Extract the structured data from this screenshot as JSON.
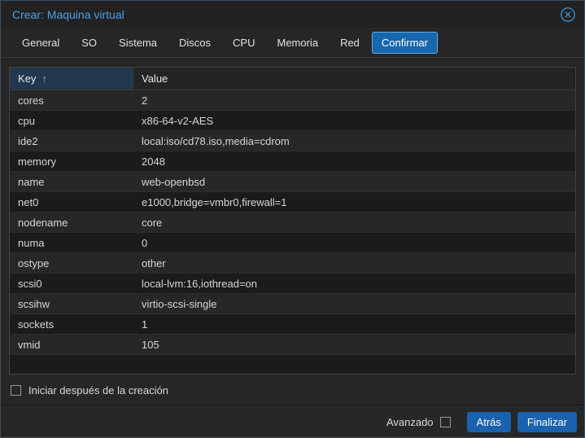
{
  "window": {
    "title": "Crear: Maquina virtual"
  },
  "icons": {
    "sort_asc_glyph": "↑"
  },
  "tabs": [
    {
      "label": "General",
      "active": false
    },
    {
      "label": "SO",
      "active": false
    },
    {
      "label": "Sistema",
      "active": false
    },
    {
      "label": "Discos",
      "active": false
    },
    {
      "label": "CPU",
      "active": false
    },
    {
      "label": "Memoria",
      "active": false
    },
    {
      "label": "Red",
      "active": false
    },
    {
      "label": "Confirmar",
      "active": true
    }
  ],
  "grid": {
    "key_header": "Key",
    "value_header": "Value",
    "sort_direction": "asc",
    "rows": [
      {
        "key": "cores",
        "value": "2"
      },
      {
        "key": "cpu",
        "value": "x86-64-v2-AES"
      },
      {
        "key": "ide2",
        "value": "local:iso/cd78.iso,media=cdrom"
      },
      {
        "key": "memory",
        "value": "2048"
      },
      {
        "key": "name",
        "value": "web-openbsd"
      },
      {
        "key": "net0",
        "value": "e1000,bridge=vmbr0,firewall=1"
      },
      {
        "key": "nodename",
        "value": "core"
      },
      {
        "key": "numa",
        "value": "0"
      },
      {
        "key": "ostype",
        "value": "other"
      },
      {
        "key": "scsi0",
        "value": "local-lvm:16,iothread=on"
      },
      {
        "key": "scsihw",
        "value": "virtio-scsi-single"
      },
      {
        "key": "sockets",
        "value": "1"
      },
      {
        "key": "vmid",
        "value": "105"
      }
    ]
  },
  "options": {
    "start_after_create_label": "Iniciar después de la creación",
    "start_after_create_checked": false
  },
  "footer": {
    "advanced_label": "Avanzado",
    "advanced_checked": false,
    "back_button": "Atrás",
    "finish_button": "Finalizar"
  },
  "colors": {
    "title_blue": "#4aa0e8",
    "accent_blue": "#1a62ae",
    "active_tab_border": "#6aabdf",
    "sorted_column_header_bg": "#21384e",
    "row_light": "#272727",
    "row_dark": "#1b1b1b",
    "close_icon_blue": "#3f8ac6"
  }
}
